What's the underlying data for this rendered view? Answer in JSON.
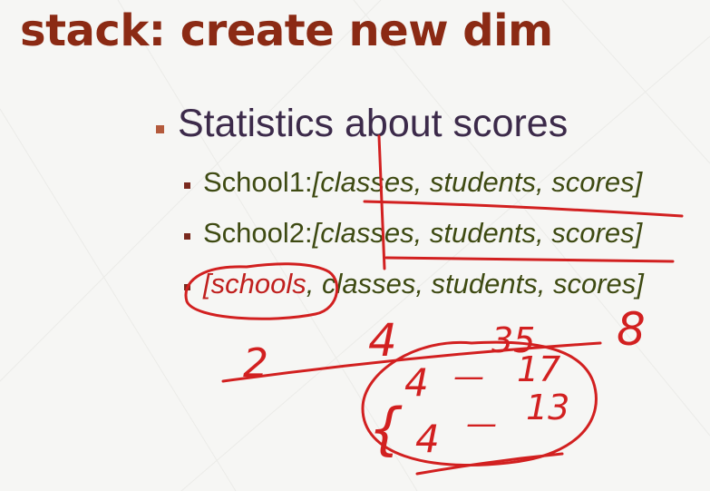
{
  "slide": {
    "title": "stack: create new dim",
    "bullet": "Statistics about scores",
    "sub_bullets": [
      {
        "label": "School1:",
        "bracket": "[classes, students, scores]"
      },
      {
        "label": "School2:",
        "bracket": "[classes, students, scores]"
      },
      {
        "highlight": "[schools",
        "rest": ", classes, students, scores]"
      }
    ]
  },
  "annotations": {
    "num_2": "2",
    "num_4": "4",
    "num_35": "35",
    "num_8": "8",
    "num_4a": "4",
    "num_dash1": "—",
    "num_17": "17",
    "num_4b": "4",
    "num_dash2": "—",
    "num_13": "13",
    "brace": "{"
  },
  "colors": {
    "title": "#8b2a14",
    "ink": "#d22020",
    "sub_text": "#3e4a12",
    "main_text": "#3c2a4a"
  }
}
